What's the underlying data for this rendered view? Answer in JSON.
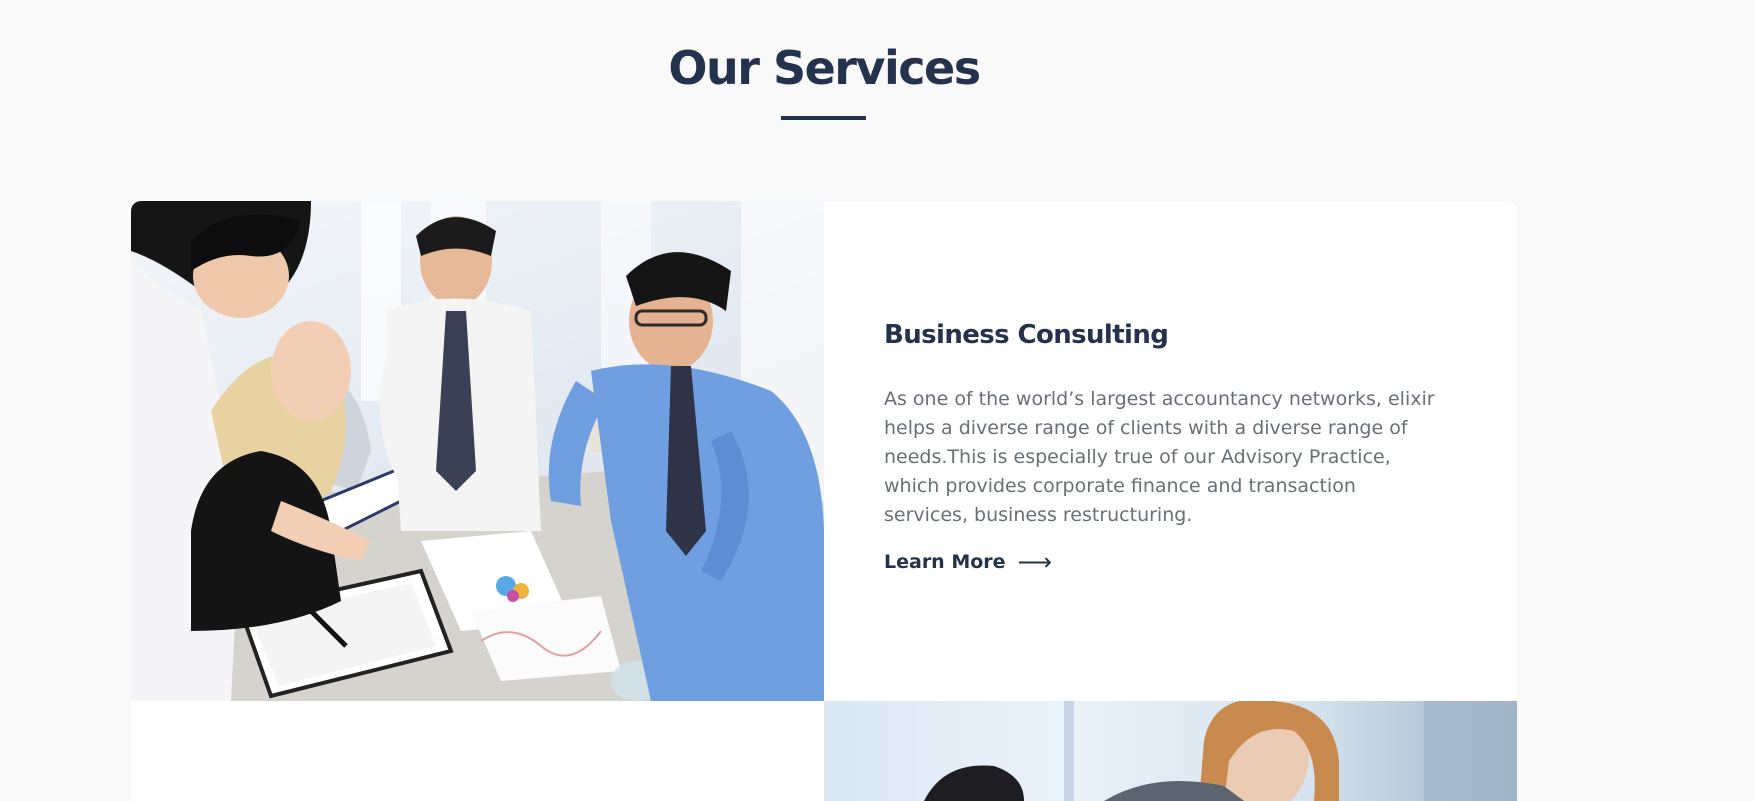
{
  "section": {
    "title": "Our Services"
  },
  "services": [
    {
      "title": "Business Consulting",
      "description": "As one of the world’s largest accountancy networks, elixir helps a diverse range of clients with a diverse range of needs.This is especially true of our Advisory Practice, which provides corporate finance and transaction services, business restructuring.",
      "link_label": "Learn More",
      "link_icon": "long-arrow-right-icon",
      "image_icon": "team-meeting-photo"
    }
  ],
  "colors": {
    "heading": "#24324d",
    "body_text": "#6a6e75",
    "page_background": "#f9f9fa",
    "card_background": "#ffffff"
  }
}
